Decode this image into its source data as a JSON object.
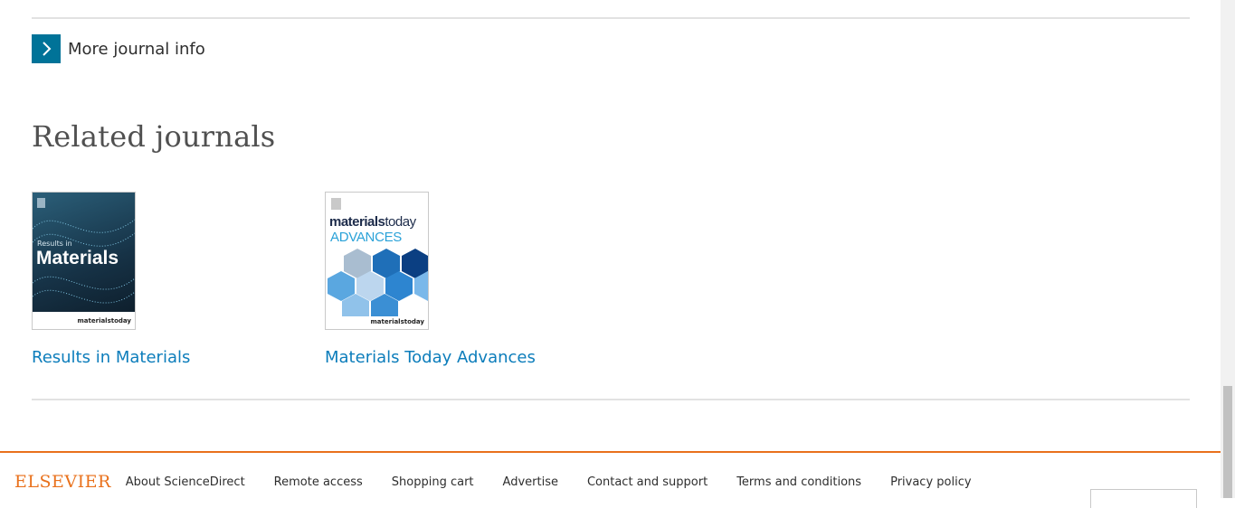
{
  "more_info": {
    "label": "More journal info",
    "icon": "chevron-right-icon"
  },
  "related": {
    "title": "Related journals",
    "journals": [
      {
        "name": "Results in Materials",
        "cover": {
          "small_text": "Results in",
          "big_text": "Materials",
          "publisher": "materialstoday"
        }
      },
      {
        "name": "Materials Today Advances",
        "cover": {
          "brand_a": "materials",
          "brand_b": "today",
          "sub": "ADVANCES",
          "publisher": "materialstoday"
        }
      }
    ]
  },
  "footer": {
    "logo": "ELSEVIER",
    "links": [
      "About ScienceDirect",
      "Remote access",
      "Shopping cart",
      "Advertise",
      "Contact and support",
      "Terms and conditions",
      "Privacy policy"
    ]
  },
  "colors": {
    "accent": "#007398",
    "link": "#0c7dbb",
    "brand": "#e9711c"
  }
}
